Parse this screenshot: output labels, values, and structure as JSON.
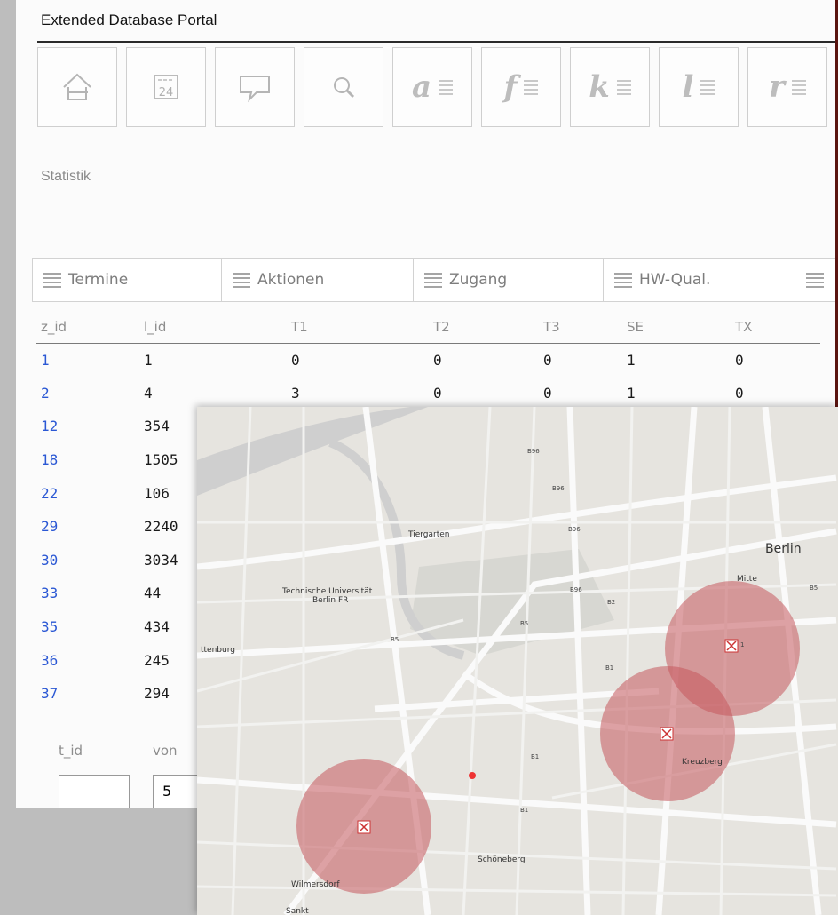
{
  "app": {
    "title": "Extended Database Portal"
  },
  "toolbar": {
    "tools": [
      {
        "name": "home",
        "icon": "home-icon",
        "letter": ""
      },
      {
        "name": "calendar",
        "icon": "calendar-icon",
        "letter": "",
        "text": "24"
      },
      {
        "name": "comment",
        "icon": "speech-bubble-icon",
        "letter": ""
      },
      {
        "name": "search",
        "icon": "search-icon",
        "letter": ""
      },
      {
        "name": "a",
        "icon": "list-icon",
        "letter": "a"
      },
      {
        "name": "f",
        "icon": "list-icon",
        "letter": "f"
      },
      {
        "name": "k",
        "icon": "list-icon",
        "letter": "k"
      },
      {
        "name": "l",
        "icon": "list-icon",
        "letter": "l"
      },
      {
        "name": "r",
        "icon": "list-icon",
        "letter": "r"
      }
    ]
  },
  "section": {
    "label": "Statistik"
  },
  "tabs": [
    {
      "label": "Termine"
    },
    {
      "label": "Aktionen"
    },
    {
      "label": "Zugang"
    },
    {
      "label": "HW-Qual."
    }
  ],
  "table": {
    "columns": [
      "z_id",
      "l_id",
      "T1",
      "T2",
      "T3",
      "SE",
      "TX"
    ],
    "rows": [
      [
        "1",
        "1",
        "0",
        "0",
        "0",
        "1",
        "0"
      ],
      [
        "2",
        "4",
        "3",
        "0",
        "0",
        "1",
        "0"
      ],
      [
        "12",
        "354",
        "",
        "",
        "",
        "",
        ""
      ],
      [
        "18",
        "1505",
        "",
        "",
        "",
        "",
        ""
      ],
      [
        "22",
        "106",
        "",
        "",
        "",
        "",
        ""
      ],
      [
        "29",
        "2240",
        "",
        "",
        "",
        "",
        ""
      ],
      [
        "30",
        "3034",
        "",
        "",
        "",
        "",
        ""
      ],
      [
        "33",
        "44",
        "",
        "",
        "",
        "",
        ""
      ],
      [
        "35",
        "434",
        "",
        "",
        "",
        "",
        ""
      ],
      [
        "36",
        "245",
        "",
        "",
        "",
        "",
        ""
      ],
      [
        "37",
        "294",
        "",
        "",
        "",
        "",
        ""
      ]
    ]
  },
  "filter": {
    "tid_label": "t_id",
    "von_label": "von",
    "tid_value": "",
    "von_value": "5"
  },
  "map": {
    "labels": {
      "berlin": "Berlin",
      "mitte": "Mitte",
      "tiergarten": "Tiergarten",
      "tu": "Technische Universität",
      "tu2": "Berlin FR",
      "kreuzberg": "Kreuzberg",
      "schoeneberg": "Schöneberg",
      "wilmersdorf": "Wilmersdorf",
      "sankt": "Sankt",
      "ttenburg": "ttenburg",
      "b96a": "B96",
      "b96b": "B96",
      "b96c": "B96",
      "b96d": "B96",
      "b5a": "B5",
      "b5b": "B5",
      "b5c": "B5",
      "b1a": "B1",
      "b1b": "B1",
      "b1c": "B1",
      "b2": "B2",
      "marker1": "1"
    },
    "circle_color": "#c4585c"
  }
}
